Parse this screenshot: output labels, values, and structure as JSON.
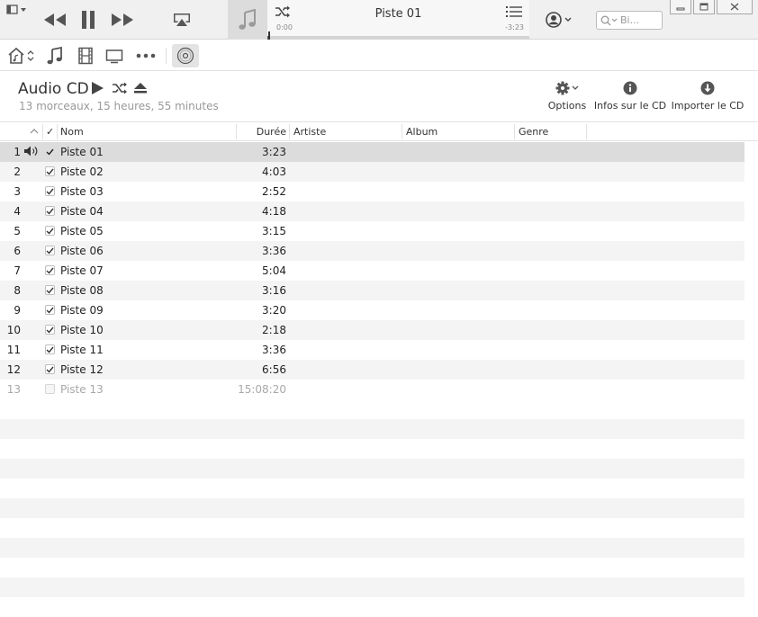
{
  "player": {
    "now_playing": "Piste 01",
    "elapsed": "0:00",
    "remaining": "-3:23",
    "progress_fraction": 0.005
  },
  "search": {
    "placeholder": "Bi..."
  },
  "header": {
    "title": "Audio CD",
    "subtitle": "13 morceaux, 15 heures, 55 minutes",
    "options_label": "Options",
    "info_label": "Infos sur le CD",
    "import_label": "Importer le CD"
  },
  "columns": {
    "checkmark": "✓",
    "name": "Nom",
    "duration": "Durée",
    "artist": "Artiste",
    "album": "Album",
    "genre": "Genre"
  },
  "tracks": [
    {
      "number": "1",
      "name": "Piste 01",
      "duration": "3:23",
      "checked": true,
      "playing": true
    },
    {
      "number": "2",
      "name": "Piste 02",
      "duration": "4:03",
      "checked": true
    },
    {
      "number": "3",
      "name": "Piste 03",
      "duration": "2:52",
      "checked": true
    },
    {
      "number": "4",
      "name": "Piste 04",
      "duration": "4:18",
      "checked": true
    },
    {
      "number": "5",
      "name": "Piste 05",
      "duration": "3:15",
      "checked": true
    },
    {
      "number": "6",
      "name": "Piste 06",
      "duration": "3:36",
      "checked": true
    },
    {
      "number": "7",
      "name": "Piste 07",
      "duration": "5:04",
      "checked": true
    },
    {
      "number": "8",
      "name": "Piste 08",
      "duration": "3:16",
      "checked": true
    },
    {
      "number": "9",
      "name": "Piste 09",
      "duration": "3:20",
      "checked": true
    },
    {
      "number": "10",
      "name": "Piste 10",
      "duration": "2:18",
      "checked": true
    },
    {
      "number": "11",
      "name": "Piste 11",
      "duration": "3:36",
      "checked": true
    },
    {
      "number": "12",
      "name": "Piste 12",
      "duration": "6:56",
      "checked": true
    },
    {
      "number": "13",
      "name": "Piste 13",
      "duration": "15:08:20",
      "checked": false,
      "disabled": true
    }
  ],
  "icons": {
    "menu": "menu-icon",
    "prev": "rewind-icon",
    "pause": "pause-icon",
    "next": "fast-forward-icon",
    "airplay": "airplay-icon",
    "music": "music-note-icon",
    "shuffle": "shuffle-icon",
    "up_next": "list-icon",
    "account": "account-icon",
    "search": "search-icon"
  }
}
